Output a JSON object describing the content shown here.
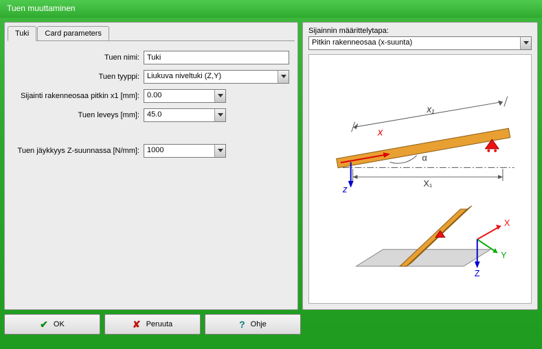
{
  "window": {
    "title": "Tuen muuttaminen"
  },
  "tabs": [
    {
      "label": "Tuki"
    },
    {
      "label": "Card parameters"
    }
  ],
  "form": {
    "name_label": "Tuen nimi:",
    "name_value": "Tuki",
    "type_label": "Tuen tyyppi:",
    "type_value": "Liukuva niveltuki (Z,Y)",
    "x1_label": "Sijainti rakenneosaa pitkin x1 [mm]:",
    "x1_value": "0.00",
    "width_label": "Tuen leveys [mm]:",
    "width_value": "45.0",
    "stiffness_label": "Tuen jäykkyys Z-suunnassa [N/mm]:",
    "stiffness_value": "1000"
  },
  "right": {
    "header": "Sijainnin määrittelytapa:",
    "combo_value": "Pitkin rakenneosaa (x-suunta)",
    "labels": {
      "x_ital": "x",
      "x1_ital": "x₁",
      "X1": "X₁",
      "alpha": "α",
      "X": "X",
      "Y": "Y",
      "Z": "Z",
      "z_low": "z"
    }
  },
  "buttons": {
    "ok": "OK",
    "cancel": "Peruuta",
    "help": "Ohje"
  }
}
